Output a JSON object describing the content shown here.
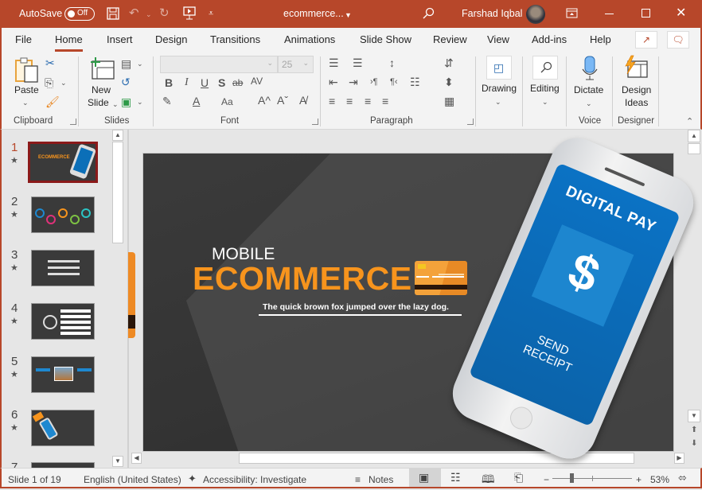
{
  "titlebar": {
    "autosave_label": "AutoSave",
    "autosave_state": "Off",
    "doc_title": "ecommerce...",
    "user_name": "Farshad Iqbal",
    "icons": [
      "save-icon",
      "undo-icon",
      "redo-icon",
      "present-from-start-icon",
      "customize-qat-icon",
      "search-icon",
      "ribbon-display-icon",
      "minimize-icon",
      "maximize-icon",
      "close-icon"
    ]
  },
  "tabs": [
    {
      "label": "File"
    },
    {
      "label": "Home",
      "active": true
    },
    {
      "label": "Insert"
    },
    {
      "label": "Design"
    },
    {
      "label": "Transitions"
    },
    {
      "label": "Animations"
    },
    {
      "label": "Slide Show"
    },
    {
      "label": "Review"
    },
    {
      "label": "View"
    },
    {
      "label": "Add-ins"
    },
    {
      "label": "Help"
    }
  ],
  "ribbon": {
    "clipboard": {
      "label": "Clipboard",
      "paste": "Paste"
    },
    "slides": {
      "label": "Slides",
      "new_slide_line1": "New",
      "new_slide_line2": "Slide"
    },
    "font": {
      "label": "Font",
      "font_name": "",
      "font_size": "25",
      "bold": "B",
      "italic": "I",
      "underline": "U",
      "shadow": "S",
      "strike": "ab",
      "spacing": "AV",
      "case": "Aa",
      "grow": "A^",
      "shrink": "Aˇ"
    },
    "paragraph": {
      "label": "Paragraph"
    },
    "drawing": {
      "label": "Drawing"
    },
    "editing": {
      "label": "Editing"
    },
    "voice": {
      "label": "Voice",
      "dictate": "Dictate"
    },
    "designer": {
      "label": "Designer",
      "design_ideas_line1": "Design",
      "design_ideas_line2": "Ideas"
    }
  },
  "thumbnails": [
    {
      "num": "1",
      "selected": true
    },
    {
      "num": "2"
    },
    {
      "num": "3"
    },
    {
      "num": "4"
    },
    {
      "num": "5"
    },
    {
      "num": "6"
    },
    {
      "num": "7"
    }
  ],
  "slide": {
    "mobile": "MOBILE",
    "ecommerce": "ECOMMERCE",
    "tagline": "The quick brown fox jumped over the lazy dog.",
    "phone_title": "DIGITAL PAY",
    "phone_symbol": "$",
    "phone_send": "SEND",
    "phone_receipt": "RECEIPT",
    "colors": {
      "accent_orange": "#f7941d",
      "phone_blue": "#0b6fb8",
      "background": "#3a3a3a"
    }
  },
  "statusbar": {
    "slide_info": "Slide 1 of 19",
    "language": "English (United States)",
    "accessibility": "Accessibility: Investigate",
    "notes": "Notes",
    "zoom": "53%",
    "zoom_fraction": 0.53
  },
  "colors": {
    "brand": "#b7472a"
  }
}
